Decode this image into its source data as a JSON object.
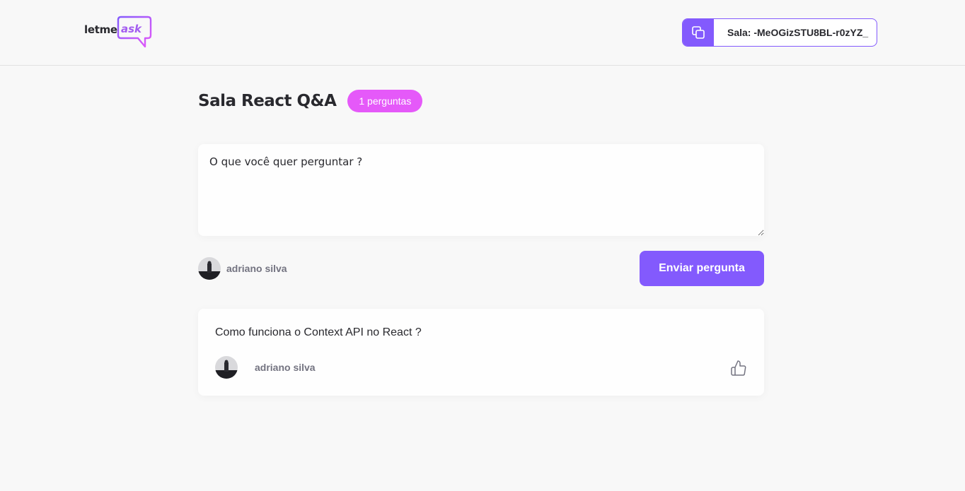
{
  "header": {
    "logo_text_letme": "letme",
    "logo_text_ask": "ask",
    "room_code_label": "Sala: -MeOGizSTU8BL-r0zYZ_",
    "copy_icon": "copy-icon"
  },
  "room": {
    "title": "Sala React Q&A",
    "question_count_badge": "1 perguntas"
  },
  "form": {
    "placeholder": "O que você quer perguntar ?",
    "user_name": "adriano silva",
    "submit_label": "Enviar pergunta"
  },
  "questions": [
    {
      "content": "Como funciona o Context API no React ?",
      "author": "adriano silva",
      "like_icon": "thumbs-up-icon"
    }
  ],
  "colors": {
    "primary": "#835afd",
    "badge": "#e559f9",
    "background": "#f8f8f8"
  }
}
